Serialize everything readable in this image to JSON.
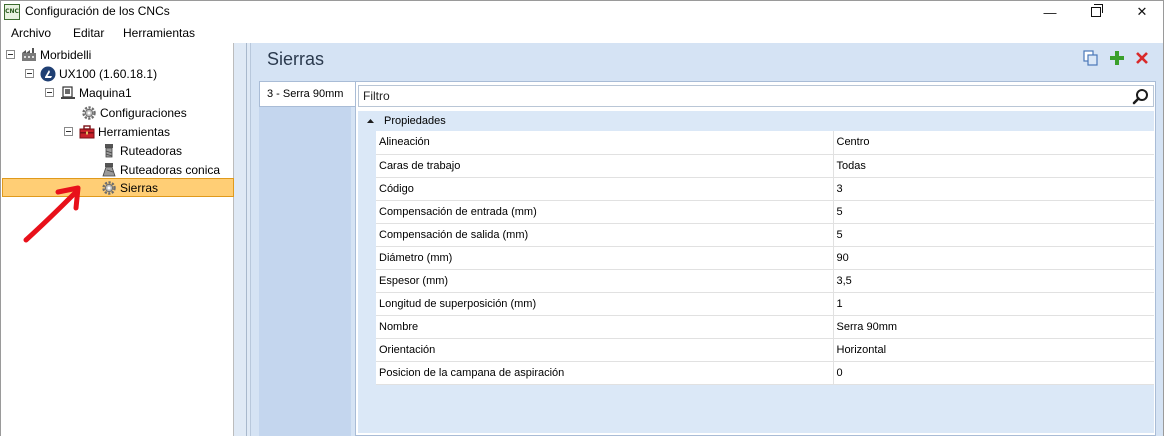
{
  "window": {
    "app_icon_text": "CNC",
    "title": "Configuración de los CNCs",
    "controls": {
      "minimize": "—",
      "close": "✕"
    }
  },
  "menu": {
    "items": [
      "Archivo",
      "Editar",
      "Herramientas"
    ]
  },
  "tree": {
    "items": [
      {
        "label": "Morbidelli",
        "icon": "factory-icon",
        "level": 0,
        "expanded": true
      },
      {
        "label": "UX100 (1.60.18.1)",
        "icon": "machine-logo-icon",
        "level": 1,
        "expanded": true
      },
      {
        "label": "Maquina1",
        "icon": "machine-icon",
        "level": 2,
        "expanded": true
      },
      {
        "label": "Configuraciones",
        "icon": "gear-icon",
        "level": 3
      },
      {
        "label": "Herramientas",
        "icon": "toolbox-icon",
        "level": 3,
        "expanded": true
      },
      {
        "label": "Ruteadoras",
        "icon": "router-tool-icon",
        "level": 4
      },
      {
        "label": "Ruteadoras conica",
        "icon": "conical-router-icon",
        "level": 4
      },
      {
        "label": "Sierras",
        "icon": "gear-icon",
        "level": 4,
        "selected": true
      }
    ]
  },
  "main": {
    "title": "Sierras",
    "actions": {
      "copy": "copy-icon",
      "add": "add-icon",
      "delete": "delete-icon"
    },
    "tabs": [
      {
        "label": "3 - Serra 90mm",
        "selected": true
      }
    ],
    "filter": {
      "placeholder": "Filtro"
    },
    "category": {
      "label": "Propiedades",
      "expanded": true
    },
    "properties": [
      {
        "name": "Alineación",
        "value": "Centro"
      },
      {
        "name": "Caras de trabajo",
        "value": "Todas"
      },
      {
        "name": "Código",
        "value": "3"
      },
      {
        "name": "Compensación de entrada (mm)",
        "value": "5"
      },
      {
        "name": "Compensación de salida (mm)",
        "value": "5"
      },
      {
        "name": "Diámetro (mm)",
        "value": "90"
      },
      {
        "name": "Espesor (mm)",
        "value": "3,5"
      },
      {
        "name": "Longitud de superposición (mm)",
        "value": "1"
      },
      {
        "name": "Nombre",
        "value": "Serra 90mm"
      },
      {
        "name": "Orientación",
        "value": "Horizontal"
      },
      {
        "name": "Posicion de la campana de aspiración",
        "value": "0"
      }
    ]
  },
  "colors": {
    "selection": "#ffce75",
    "panel_background": "#d5e3f4",
    "add_accent": "#3aa02b",
    "delete_accent": "#d92a2a",
    "annotation_arrow": "#e8101a"
  }
}
